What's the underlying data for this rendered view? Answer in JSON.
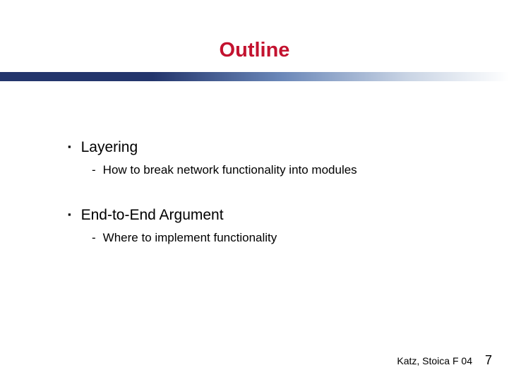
{
  "title": "Outline",
  "bullets": [
    {
      "text": "Layering",
      "sub": "How to break network functionality into modules"
    },
    {
      "text": "End-to-End Argument",
      "sub": "Where to implement functionality"
    }
  ],
  "footer": {
    "author": "Katz, Stoica F 04",
    "page": "7"
  }
}
